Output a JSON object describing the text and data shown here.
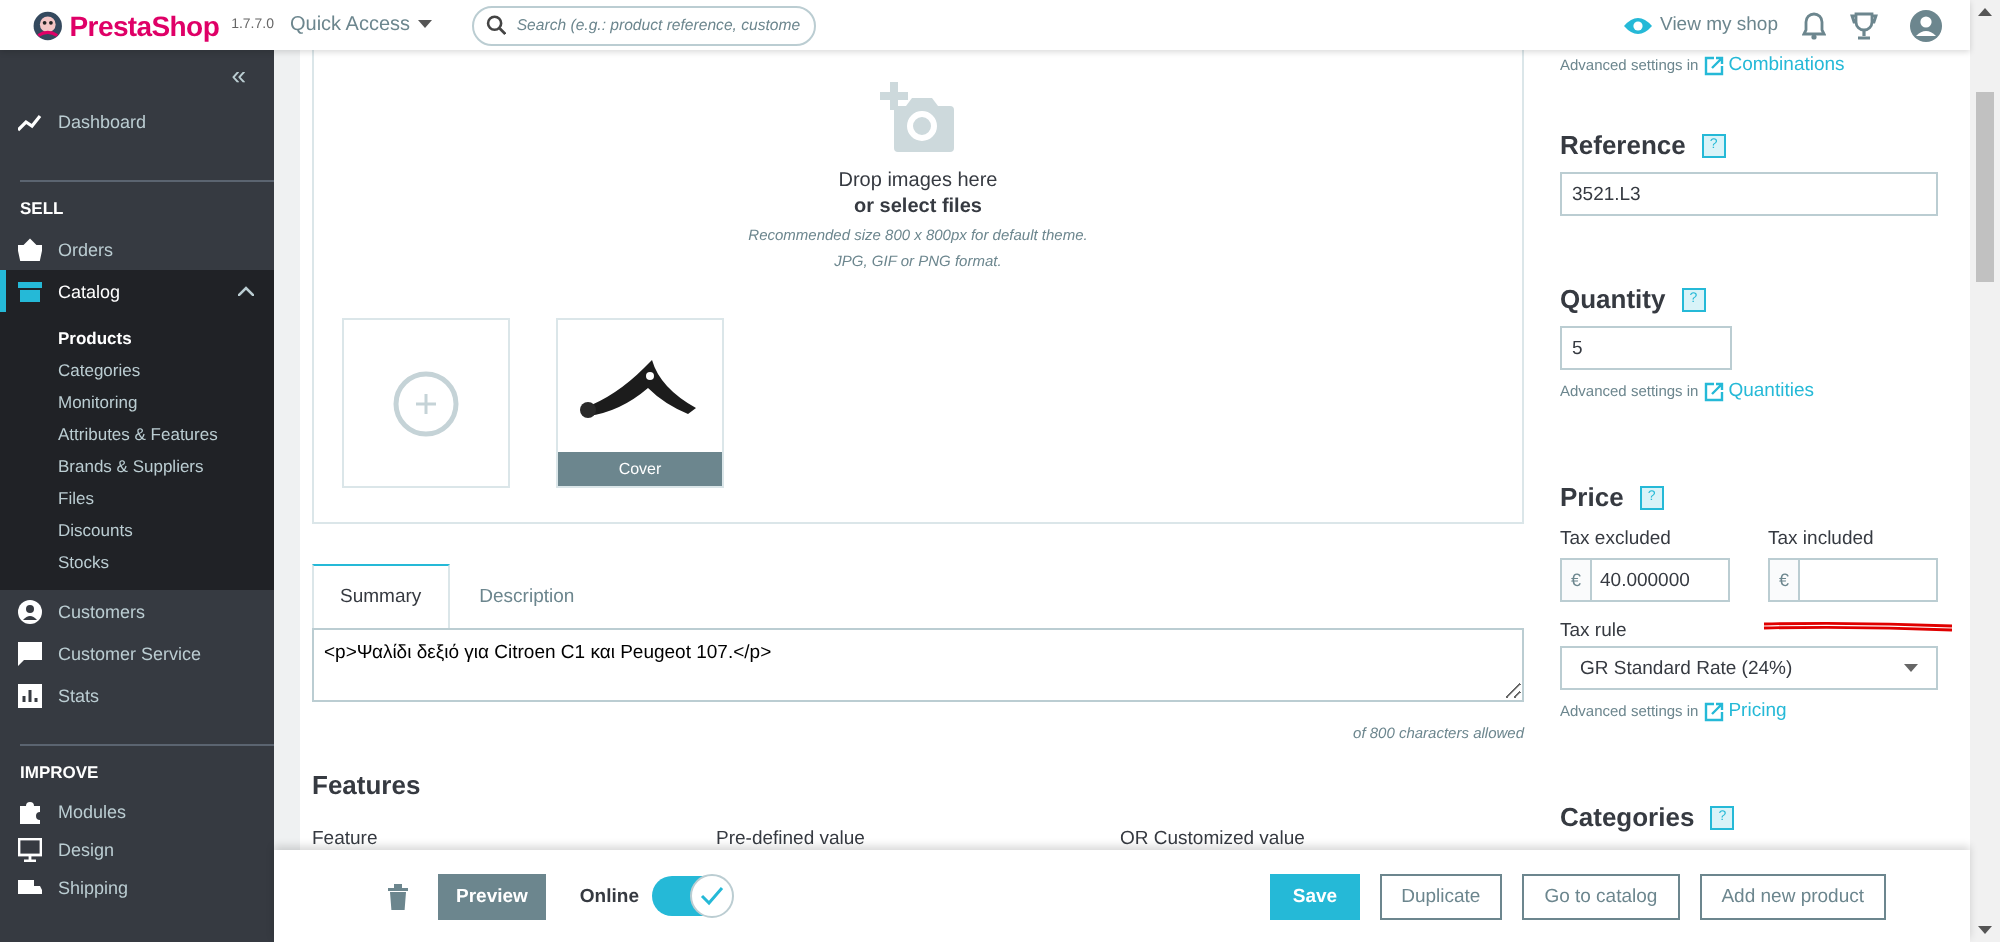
{
  "header": {
    "logo": "PrestaShop",
    "version": "1.7.7.0",
    "quick_access": "Quick Access",
    "search": {
      "placeholder": "Search (e.g.: product reference, custome"
    },
    "view_shop": "View my shop"
  },
  "sidebar": {
    "collapse": "«",
    "sections": [
      {
        "items": [
          {
            "label": "Dashboard",
            "selected": false
          }
        ]
      },
      {
        "heading": "SELL",
        "items": [
          {
            "label": "Orders",
            "selected": false
          },
          {
            "label": "Catalog",
            "selected": true,
            "expanded": true,
            "children": [
              {
                "label": "Products",
                "selected": true
              },
              {
                "label": "Categories",
                "selected": false
              },
              {
                "label": "Monitoring",
                "selected": false
              },
              {
                "label": "Attributes & Features",
                "selected": false
              },
              {
                "label": "Brands & Suppliers",
                "selected": false
              },
              {
                "label": "Files",
                "selected": false
              },
              {
                "label": "Discounts",
                "selected": false
              },
              {
                "label": "Stocks",
                "selected": false
              }
            ]
          },
          {
            "label": "Customers",
            "selected": false
          },
          {
            "label": "Customer Service",
            "selected": false
          },
          {
            "label": "Stats",
            "selected": false
          }
        ]
      },
      {
        "heading": "IMPROVE",
        "items": [
          {
            "label": "Modules",
            "selected": false
          },
          {
            "label": "Design",
            "selected": false
          },
          {
            "label": "Shipping",
            "selected": false
          }
        ]
      }
    ]
  },
  "dropzone": {
    "line1": "Drop images here",
    "line2": "or select files",
    "hint1": "Recommended size 800 x 800px for default theme.",
    "hint2": "JPG, GIF or PNG format."
  },
  "images": [
    {
      "kind": "add"
    },
    {
      "kind": "photo",
      "caption": "Cover"
    }
  ],
  "tabs": [
    {
      "label": "Summary",
      "selected": true
    },
    {
      "label": "Description",
      "selected": false
    }
  ],
  "summary": {
    "value": "<p>Ψαλίδι δεξιό για Citroen C1 και Peugeot 107.</p>",
    "counter": "of 800 characters allowed"
  },
  "features": {
    "title": "Features",
    "columns": [
      "Feature",
      "Pre-defined value",
      "OR Customized value"
    ]
  },
  "right": {
    "combinations": {
      "prefix": "Advanced settings in",
      "link": "Combinations"
    },
    "reference": {
      "title": "Reference",
      "help": "?",
      "value": "3521.L3"
    },
    "quantity": {
      "title": "Quantity",
      "help": "?",
      "value": "5",
      "advanced": {
        "prefix": "Advanced settings in",
        "link": "Quantities"
      }
    },
    "price": {
      "title": "Price",
      "help": "?",
      "tax_excluded": {
        "label": "Tax excluded",
        "currency": "€",
        "value": "40.000000"
      },
      "tax_included": {
        "label": "Tax included",
        "currency": "€"
      },
      "tax_rule": {
        "label": "Tax rule",
        "value": "GR Standard Rate (24%)"
      },
      "advanced": {
        "prefix": "Advanced settings in",
        "link": "Pricing"
      }
    },
    "categories": {
      "title": "Categories",
      "help": "?"
    }
  },
  "footer": {
    "preview": "Preview",
    "online": {
      "label": "Online",
      "on": true
    },
    "actions": [
      {
        "label": "Save",
        "primary": true
      },
      {
        "label": "Duplicate",
        "primary": false
      },
      {
        "label": "Go to catalog",
        "primary": false
      },
      {
        "label": "Add new product",
        "primary": false
      }
    ]
  }
}
